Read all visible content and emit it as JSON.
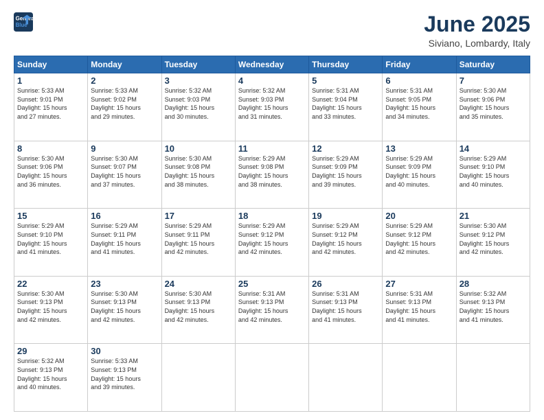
{
  "header": {
    "logo_line1": "General",
    "logo_line2": "Blue",
    "title": "June 2025",
    "subtitle": "Siviano, Lombardy, Italy"
  },
  "days_of_week": [
    "Sunday",
    "Monday",
    "Tuesday",
    "Wednesday",
    "Thursday",
    "Friday",
    "Saturday"
  ],
  "weeks": [
    [
      {
        "day": "1",
        "info": "Sunrise: 5:33 AM\nSunset: 9:01 PM\nDaylight: 15 hours\nand 27 minutes."
      },
      {
        "day": "2",
        "info": "Sunrise: 5:33 AM\nSunset: 9:02 PM\nDaylight: 15 hours\nand 29 minutes."
      },
      {
        "day": "3",
        "info": "Sunrise: 5:32 AM\nSunset: 9:03 PM\nDaylight: 15 hours\nand 30 minutes."
      },
      {
        "day": "4",
        "info": "Sunrise: 5:32 AM\nSunset: 9:03 PM\nDaylight: 15 hours\nand 31 minutes."
      },
      {
        "day": "5",
        "info": "Sunrise: 5:31 AM\nSunset: 9:04 PM\nDaylight: 15 hours\nand 33 minutes."
      },
      {
        "day": "6",
        "info": "Sunrise: 5:31 AM\nSunset: 9:05 PM\nDaylight: 15 hours\nand 34 minutes."
      },
      {
        "day": "7",
        "info": "Sunrise: 5:30 AM\nSunset: 9:06 PM\nDaylight: 15 hours\nand 35 minutes."
      }
    ],
    [
      {
        "day": "8",
        "info": "Sunrise: 5:30 AM\nSunset: 9:06 PM\nDaylight: 15 hours\nand 36 minutes."
      },
      {
        "day": "9",
        "info": "Sunrise: 5:30 AM\nSunset: 9:07 PM\nDaylight: 15 hours\nand 37 minutes."
      },
      {
        "day": "10",
        "info": "Sunrise: 5:30 AM\nSunset: 9:08 PM\nDaylight: 15 hours\nand 38 minutes."
      },
      {
        "day": "11",
        "info": "Sunrise: 5:29 AM\nSunset: 9:08 PM\nDaylight: 15 hours\nand 38 minutes."
      },
      {
        "day": "12",
        "info": "Sunrise: 5:29 AM\nSunset: 9:09 PM\nDaylight: 15 hours\nand 39 minutes."
      },
      {
        "day": "13",
        "info": "Sunrise: 5:29 AM\nSunset: 9:09 PM\nDaylight: 15 hours\nand 40 minutes."
      },
      {
        "day": "14",
        "info": "Sunrise: 5:29 AM\nSunset: 9:10 PM\nDaylight: 15 hours\nand 40 minutes."
      }
    ],
    [
      {
        "day": "15",
        "info": "Sunrise: 5:29 AM\nSunset: 9:10 PM\nDaylight: 15 hours\nand 41 minutes."
      },
      {
        "day": "16",
        "info": "Sunrise: 5:29 AM\nSunset: 9:11 PM\nDaylight: 15 hours\nand 41 minutes."
      },
      {
        "day": "17",
        "info": "Sunrise: 5:29 AM\nSunset: 9:11 PM\nDaylight: 15 hours\nand 42 minutes."
      },
      {
        "day": "18",
        "info": "Sunrise: 5:29 AM\nSunset: 9:12 PM\nDaylight: 15 hours\nand 42 minutes."
      },
      {
        "day": "19",
        "info": "Sunrise: 5:29 AM\nSunset: 9:12 PM\nDaylight: 15 hours\nand 42 minutes."
      },
      {
        "day": "20",
        "info": "Sunrise: 5:29 AM\nSunset: 9:12 PM\nDaylight: 15 hours\nand 42 minutes."
      },
      {
        "day": "21",
        "info": "Sunrise: 5:30 AM\nSunset: 9:12 PM\nDaylight: 15 hours\nand 42 minutes."
      }
    ],
    [
      {
        "day": "22",
        "info": "Sunrise: 5:30 AM\nSunset: 9:13 PM\nDaylight: 15 hours\nand 42 minutes."
      },
      {
        "day": "23",
        "info": "Sunrise: 5:30 AM\nSunset: 9:13 PM\nDaylight: 15 hours\nand 42 minutes."
      },
      {
        "day": "24",
        "info": "Sunrise: 5:30 AM\nSunset: 9:13 PM\nDaylight: 15 hours\nand 42 minutes."
      },
      {
        "day": "25",
        "info": "Sunrise: 5:31 AM\nSunset: 9:13 PM\nDaylight: 15 hours\nand 42 minutes."
      },
      {
        "day": "26",
        "info": "Sunrise: 5:31 AM\nSunset: 9:13 PM\nDaylight: 15 hours\nand 41 minutes."
      },
      {
        "day": "27",
        "info": "Sunrise: 5:31 AM\nSunset: 9:13 PM\nDaylight: 15 hours\nand 41 minutes."
      },
      {
        "day": "28",
        "info": "Sunrise: 5:32 AM\nSunset: 9:13 PM\nDaylight: 15 hours\nand 41 minutes."
      }
    ],
    [
      {
        "day": "29",
        "info": "Sunrise: 5:32 AM\nSunset: 9:13 PM\nDaylight: 15 hours\nand 40 minutes."
      },
      {
        "day": "30",
        "info": "Sunrise: 5:33 AM\nSunset: 9:13 PM\nDaylight: 15 hours\nand 39 minutes."
      },
      {
        "day": "",
        "info": ""
      },
      {
        "day": "",
        "info": ""
      },
      {
        "day": "",
        "info": ""
      },
      {
        "day": "",
        "info": ""
      },
      {
        "day": "",
        "info": ""
      }
    ]
  ]
}
